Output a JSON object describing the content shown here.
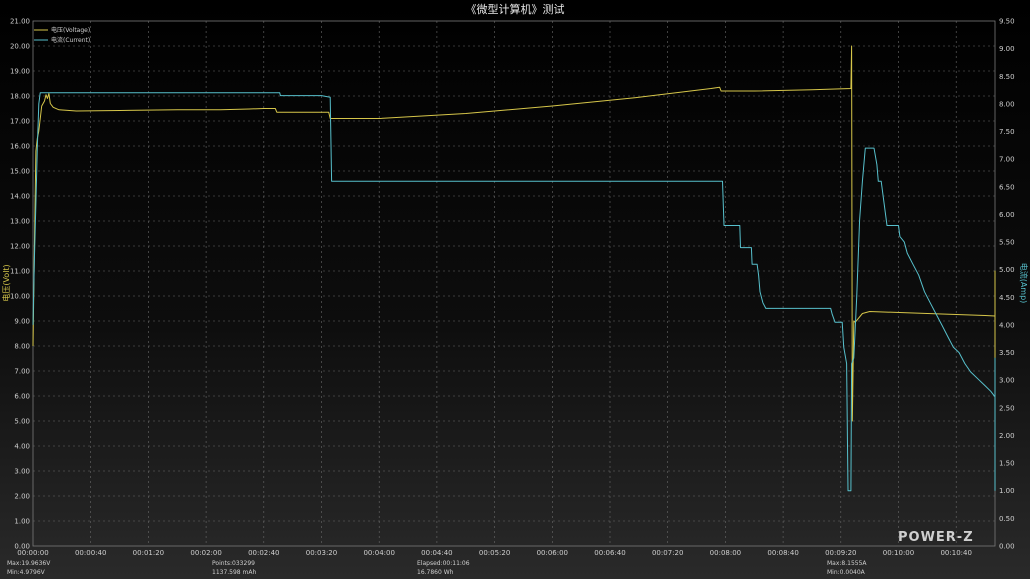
{
  "title": "《微型计算机》测试",
  "chart_data": {
    "type": "line",
    "title": "《微型计算机》测试",
    "xlabel": "",
    "ylabel_left": "电压(Volt)",
    "ylabel_right": "电流(Amp)",
    "ylim_left": [
      0,
      21
    ],
    "ylim_right": [
      0,
      9.5
    ],
    "xlim_seconds": [
      0,
      670
    ],
    "x_ticks": [
      "00:00:00",
      "00:00:40",
      "00:01:20",
      "00:02:00",
      "00:02:40",
      "00:03:20",
      "00:04:00",
      "00:04:40",
      "00:05:20",
      "00:06:00",
      "00:06:40",
      "00:07:20",
      "00:08:00",
      "00:08:40",
      "00:09:20",
      "00:10:00",
      "00:10:40"
    ],
    "y_ticks_left": [
      "0.00",
      "1.00",
      "2.00",
      "3.00",
      "4.00",
      "5.00",
      "6.00",
      "7.00",
      "8.00",
      "9.00",
      "10.00",
      "11.00",
      "12.00",
      "13.00",
      "14.00",
      "15.00",
      "16.00",
      "17.00",
      "18.00",
      "19.00",
      "20.00",
      "21.00"
    ],
    "y_ticks_right": [
      "0.00",
      "0.50",
      "1.00",
      "1.50",
      "2.00",
      "2.50",
      "3.00",
      "3.50",
      "4.00",
      "4.50",
      "5.00",
      "5.50",
      "6.00",
      "6.50",
      "7.00",
      "7.50",
      "8.00",
      "8.50",
      "9.00",
      "9.50"
    ],
    "grid": true,
    "legend_position": "top-left",
    "series": [
      {
        "name": "电压(Voltage)",
        "color": "#d6c64a",
        "axis": "left",
        "points": [
          [
            0,
            8
          ],
          [
            1,
            12
          ],
          [
            2,
            15.8
          ],
          [
            3,
            16.3
          ],
          [
            4,
            16.6
          ],
          [
            6,
            17.6
          ],
          [
            8,
            17.8
          ],
          [
            9,
            18.05
          ],
          [
            10,
            17.9
          ],
          [
            11,
            18.1
          ],
          [
            12,
            17.7
          ],
          [
            14,
            17.55
          ],
          [
            18,
            17.45
          ],
          [
            30,
            17.4
          ],
          [
            60,
            17.42
          ],
          [
            100,
            17.45
          ],
          [
            130,
            17.45
          ],
          [
            150,
            17.48
          ],
          [
            160,
            17.5
          ],
          [
            168,
            17.5
          ],
          [
            169,
            17.35
          ],
          [
            200,
            17.35
          ],
          [
            205,
            17.35
          ],
          [
            206,
            17.1
          ],
          [
            240,
            17.1
          ],
          [
            300,
            17.3
          ],
          [
            360,
            17.6
          ],
          [
            420,
            17.95
          ],
          [
            470,
            18.3
          ],
          [
            476,
            18.35
          ],
          [
            477,
            18.2
          ],
          [
            500,
            18.2
          ],
          [
            540,
            18.25
          ],
          [
            567,
            18.3
          ],
          [
            567.5,
            20
          ],
          [
            568,
            5
          ],
          [
            569,
            9
          ],
          [
            570,
            8.95
          ],
          [
            575,
            9.3
          ],
          [
            580,
            9.38
          ],
          [
            620,
            9.3
          ],
          [
            660,
            9.22
          ],
          [
            669,
            9.2
          ],
          [
            669.5,
            11.0
          ],
          [
            670,
            5.0
          ],
          [
            690,
            5.0
          ]
        ]
      },
      {
        "name": "电流(Current)",
        "color": "#57c0cc",
        "axis": "right",
        "points": [
          [
            0,
            4.0
          ],
          [
            1,
            5.2
          ],
          [
            2,
            6.2
          ],
          [
            3,
            7.2
          ],
          [
            4,
            8.0
          ],
          [
            5,
            8.2
          ],
          [
            171,
            8.2
          ],
          [
            171.5,
            8.15
          ],
          [
            200,
            8.15
          ],
          [
            206,
            8.12
          ],
          [
            207,
            6.6
          ],
          [
            478,
            6.6
          ],
          [
            479,
            5.8
          ],
          [
            490,
            5.8
          ],
          [
            490.5,
            5.4
          ],
          [
            498,
            5.4
          ],
          [
            498.5,
            5.1
          ],
          [
            502,
            5.1
          ],
          [
            503,
            4.9
          ],
          [
            504,
            4.6
          ],
          [
            506,
            4.4
          ],
          [
            508,
            4.3
          ],
          [
            553,
            4.3
          ],
          [
            554,
            4.2
          ],
          [
            556,
            4.05
          ],
          [
            561,
            4.05
          ],
          [
            562,
            3.6
          ],
          [
            564,
            3.3
          ],
          [
            565,
            1.0
          ],
          [
            567,
            1.0
          ],
          [
            567.5,
            3.3
          ],
          [
            569,
            3.4
          ],
          [
            571,
            4.5
          ],
          [
            573,
            5.9
          ],
          [
            575,
            6.6
          ],
          [
            577,
            7.2
          ],
          [
            583,
            7.2
          ],
          [
            585,
            6.9
          ],
          [
            586,
            6.6
          ],
          [
            588,
            6.6
          ],
          [
            590,
            6.2
          ],
          [
            592,
            5.8
          ],
          [
            600,
            5.8
          ],
          [
            601,
            5.6
          ],
          [
            604,
            5.5
          ],
          [
            606,
            5.3
          ],
          [
            610,
            5.1
          ],
          [
            614,
            4.9
          ],
          [
            618,
            4.6
          ],
          [
            622,
            4.4
          ],
          [
            626,
            4.2
          ],
          [
            630,
            4.0
          ],
          [
            634,
            3.8
          ],
          [
            638,
            3.6
          ],
          [
            642,
            3.5
          ],
          [
            646,
            3.3
          ],
          [
            650,
            3.15
          ],
          [
            656,
            3.0
          ],
          [
            660,
            2.9
          ],
          [
            664,
            2.8
          ],
          [
            667,
            2.7
          ],
          [
            667.5,
            3.4
          ],
          [
            669,
            3.4
          ],
          [
            669.5,
            1.0
          ],
          [
            690,
            1.0
          ]
        ]
      }
    ]
  },
  "legend": {
    "voltage": "电压(Voltage)",
    "current": "电流(Current)"
  },
  "stats": {
    "max_voltage": "Max:19.9636V",
    "min_voltage": "Min:4.9796V",
    "points": "Points:033299",
    "capacity": "1137.598 mAh",
    "elapsed": "Elapsed:00:11:06",
    "energy": "16.7860 Wh",
    "max_current": "Max:8.1555A",
    "min_current": "Min:0.0040A"
  },
  "logo": "POWER-Z",
  "colors": {
    "voltage": "#d6c64a",
    "current": "#57c0cc"
  }
}
